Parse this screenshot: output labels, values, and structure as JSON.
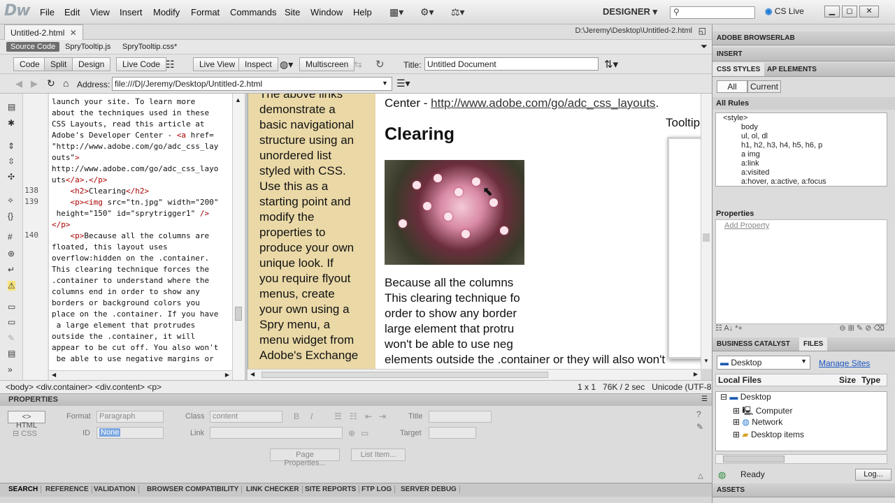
{
  "app": {
    "logo": "Dw",
    "workspace": "DESIGNER",
    "cs_live": "CS Live"
  },
  "menu": [
    "File",
    "Edit",
    "View",
    "Insert",
    "Modify",
    "Format",
    "Commands",
    "Site",
    "Window",
    "Help"
  ],
  "document": {
    "tab": "Untitled-2.html",
    "path": "D:\\Jeremy\\Desktop\\Untitled-2.html",
    "related_files": [
      "Source Code",
      "SpryTooltip.js",
      "SpryTooltip.css*"
    ],
    "views": [
      "Code",
      "Split",
      "Design"
    ],
    "live_buttons": [
      "Live Code",
      "Live View",
      "Inspect",
      "Multiscreen"
    ],
    "title_label": "Title:",
    "title_value": "Untitled Document",
    "address_label": "Address:",
    "address_value": "file:///D|/Jeremy/Desktop/Untitled-2.html"
  },
  "code": {
    "line_numbers": [
      {
        "n": "138",
        "row": 8
      },
      {
        "n": "139",
        "row": 9
      },
      {
        "n": "140",
        "row": 12
      }
    ],
    "lines": [
      "launch your site. To learn more",
      "about the techniques used in these",
      "CSS Layouts, read this article at",
      "Adobe's Developer Center - <a href=",
      "\"http://www.adobe.com/go/adc_css_lay",
      "outs\">",
      "http://www.adobe.com/go/adc_css_layo",
      "uts</a>.</p>",
      "    <h2>Clearing</h2>",
      "    <p><img src=\"tn.jpg\" width=\"200\"",
      " height=\"150\" id=\"sprytrigger1\" />",
      "</p>",
      "    <p>Because all the columns are",
      "floated, this layout uses",
      "overflow:hidden on the .container.",
      "This clearing technique forces the",
      ".container to understand where the",
      "columns end in order to show any",
      "borders or background colors you",
      "place on the .container. If you have",
      " a large element that protrudes",
      "outside the .container, it will",
      "appear to be cut off. You also won't",
      " be able to use negative margins or"
    ]
  },
  "design": {
    "sidebar_lines": [
      "The above links",
      "demonstrate a",
      "basic navigational",
      "structure using an",
      "unordered list",
      "styled with CSS.",
      "Use this as a",
      "starting point and",
      "modify the",
      "properties to",
      "produce your own",
      "unique look. If",
      "you require flyout",
      "menus, create",
      "your own using a",
      "Spry menu, a",
      "menu widget from",
      "Adobe's Exchange"
    ],
    "adc_prefix": "Center - ",
    "adc_link": "http://www.adobe.com/go/adc_css_layouts",
    "adc_suffix": ".",
    "heading": "Clearing",
    "tooltip": "Tooltip content goes here.",
    "body_lines": [
      "Because all the columns",
      "This clearing technique fo",
      "order to show any border",
      "large element that protru",
      "won't be able to use neg",
      "elements outside the .container or they will also won't"
    ]
  },
  "status": {
    "tag_selector": "<body> <div.container> <div.content> <p>",
    "zoom": "1 x 1",
    "size": "76K / 2 sec",
    "encoding": "Unicode (UTF-8)"
  },
  "properties": {
    "header": "PROPERTIES",
    "html_btn": "HTML",
    "css_btn": "CSS",
    "format_label": "Format",
    "format_value": "Paragraph",
    "class_label": "Class",
    "class_value": "content",
    "title_label": "Title",
    "id_label": "ID",
    "id_value": "None",
    "link_label": "Link",
    "target_label": "Target",
    "page_props": "Page Properties...",
    "list_item": "List Item..."
  },
  "bottom_tabs": [
    "SEARCH",
    "REFERENCE",
    "VALIDATION",
    "BROWSER COMPATIBILITY",
    "LINK CHECKER",
    "SITE REPORTS",
    "FTP LOG",
    "SERVER DEBUG"
  ],
  "panels": {
    "browserlab": "ADOBE BROWSERLAB",
    "insert": "INSERT",
    "css_styles": "CSS STYLES",
    "ap_elements": "AP ELEMENTS",
    "all_btn": "All",
    "current_btn": "Current",
    "all_rules": "All Rules",
    "rules": [
      "<style>",
      "body",
      "ul, ol, dl",
      "h1, h2, h3, h4, h5, h6, p",
      "a img",
      "a:link",
      "a:visited",
      "a:hover, a:active, a:focus"
    ],
    "properties_label": "Properties",
    "add_property": "Add Property",
    "business_catalyst": "BUSINESS CATALYST",
    "files": "FILES",
    "site_select": "Desktop",
    "manage_sites": "Manage Sites",
    "local_files": "Local Files",
    "size_col": "Size",
    "type_col": "Type",
    "file_items": [
      "Desktop",
      "Computer",
      "Network",
      "Desktop items"
    ],
    "ready": "Ready",
    "log_btn": "Log...",
    "assets": "ASSETS"
  }
}
